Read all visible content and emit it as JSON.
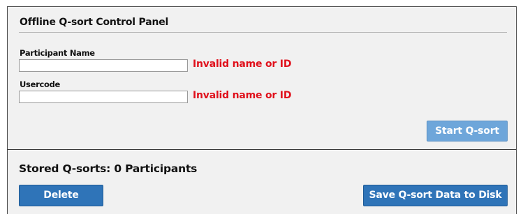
{
  "control_panel": {
    "title": "Offline Q-sort Control Panel",
    "participant_name": {
      "label": "Participant Name",
      "value": "",
      "error": "Invalid name or ID"
    },
    "usercode": {
      "label": "Usercode",
      "value": "",
      "error": "Invalid name or ID"
    },
    "start_button": "Start Q-sort"
  },
  "stored": {
    "title": "Stored Q-sorts: 0 Participants",
    "delete_button": "Delete",
    "save_button": "Save Q-sort Data to Disk"
  },
  "colors": {
    "error": "#e0111c",
    "start_button_bg": "#6ea6da",
    "primary_button_bg": "#2f74b8",
    "panel_bg": "#f1f1f1"
  }
}
